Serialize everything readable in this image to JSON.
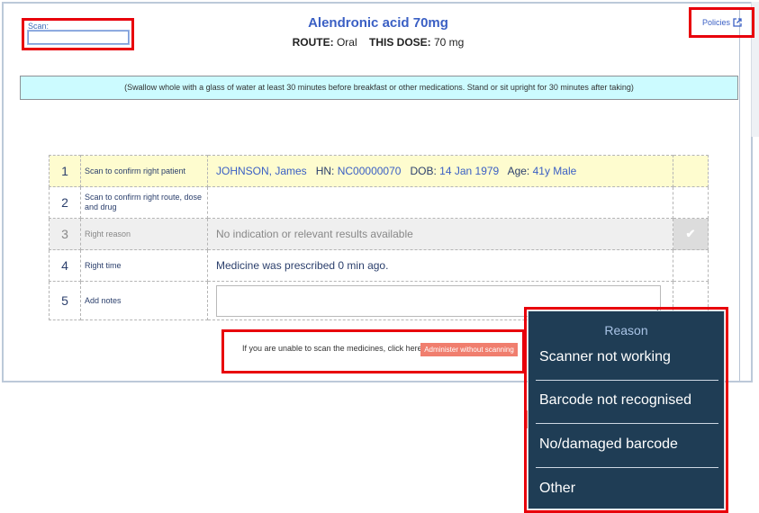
{
  "scan": {
    "label": "Scan:",
    "value": ""
  },
  "medication": {
    "title": "Alendronic acid 70mg",
    "route_label": "ROUTE:",
    "route_value": "Oral",
    "dose_label": "THIS DOSE:",
    "dose_value": "70 mg"
  },
  "policies": {
    "label": "Policies",
    "icon": "external-link-icon"
  },
  "instruction": "(Swallow whole with a glass of water at least 30 minutes before breakfast or other medications. Stand or sit upright for 30 minutes after taking)",
  "checklist": [
    {
      "num": "1",
      "label": "Scan to confirm right patient"
    },
    {
      "num": "2",
      "label": "Scan to confirm right route, dose and drug",
      "value": ""
    },
    {
      "num": "3",
      "label": "Right reason",
      "value": "No indication or relevant results available",
      "checked": true
    },
    {
      "num": "4",
      "label": "Right time",
      "value": "Medicine was prescribed 0 min ago."
    },
    {
      "num": "5",
      "label": "Add notes",
      "value": ""
    }
  ],
  "patient": {
    "name": "JOHNSON, James",
    "hn_label": "HN:",
    "hn": "NC00000070",
    "dob_label": "DOB:",
    "dob": "14 Jan 1979",
    "age_label": "Age:",
    "age": "41y Male"
  },
  "unable_text": "If you are unable to scan the medicines, click here",
  "administer_button": "Administer without scanning",
  "reason_popup": {
    "title": "Reason",
    "options": [
      "Scanner not working",
      "Barcode not recognised",
      "No/damaged barcode",
      "Other"
    ]
  },
  "colors": {
    "title_blue": "#3a5fc4",
    "highlight_red": "#e8000b",
    "instruction_bg": "#ccfbff",
    "row1_bg": "#fefccf",
    "button_salmon": "#f07e6e",
    "popup_bg": "#1f3d55"
  }
}
